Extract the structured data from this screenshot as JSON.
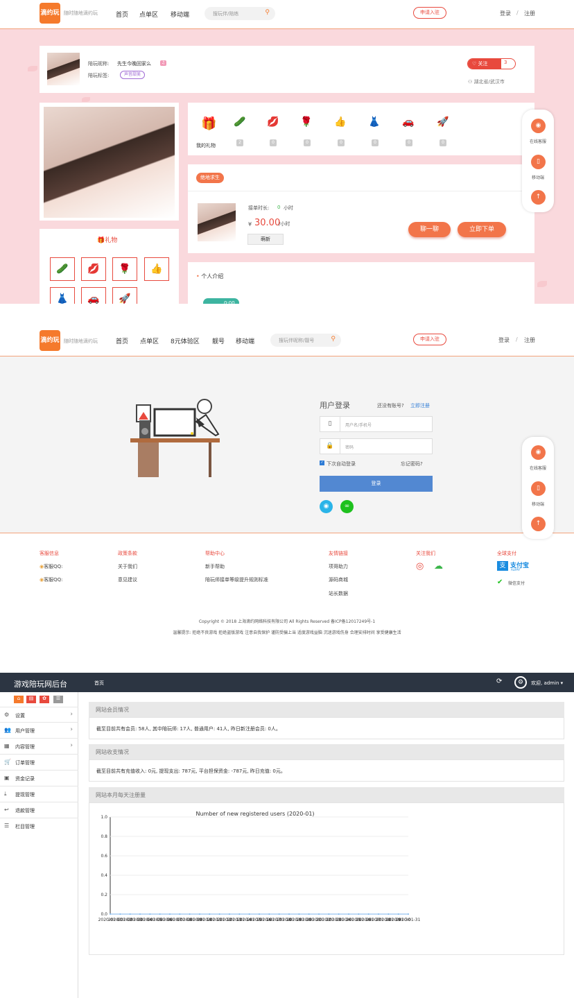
{
  "site": {
    "logo": "滴约玩",
    "slogan": "随时随地滴约玩",
    "nav1": [
      "首页",
      "点单区",
      "移动端"
    ],
    "nav2": [
      "首页",
      "点单区",
      "8元体验区",
      "靓号",
      "移动端"
    ],
    "search1": "搜玩伴/陪练",
    "search2": "搜玩伴昵称/靓号",
    "apply": "申请入驻",
    "login": "登录",
    "sep": "/",
    "register": "注册"
  },
  "profile": {
    "name_label": "陪玩昵称:",
    "name": "先生今晚回家么",
    "tag_label": "陪玩标签:",
    "tag": "声音甜美",
    "follow": "关注",
    "follow_count": "3",
    "location": "湖北省/武汉市"
  },
  "gifts": {
    "title": "我的礼物",
    "items": [
      {
        "icon": "gift-box",
        "emoji": "🎁"
      },
      {
        "icon": "cucumber",
        "emoji": "🥒",
        "count": "2"
      },
      {
        "icon": "lips",
        "emoji": "💋",
        "count": "0"
      },
      {
        "icon": "rose",
        "emoji": "🌹",
        "count": "0"
      },
      {
        "icon": "thumbs-up",
        "emoji": "👍",
        "count": "0"
      },
      {
        "icon": "dress",
        "emoji": "👗",
        "count": "0"
      },
      {
        "icon": "car",
        "emoji": "🚗",
        "count": "0"
      },
      {
        "icon": "rocket",
        "emoji": "🚀",
        "count": "0"
      }
    ],
    "panel_title": "礼物",
    "panel_items": [
      "🥒",
      "💋",
      "🌹",
      "👍",
      "👗",
      "🚗",
      "🚀"
    ]
  },
  "game": {
    "tag": "绝地求生",
    "duration_label": "接单时长:",
    "duration": "0",
    "duration_unit": "小时",
    "currency": "¥",
    "price": "30.00",
    "price_unit": "/小时",
    "newbie": "萌新",
    "chat": "聊一聊",
    "order": "立即下单"
  },
  "intro": {
    "title": "个人介绍",
    "audio": "0:00"
  },
  "side": {
    "service": "在线客服",
    "mobile": "移动端"
  },
  "loginform": {
    "title": "用户登录",
    "no_account": "还没有账号?",
    "signup": "立即注册",
    "user_ph": "用户名/手机号",
    "pass_ph": "密码",
    "remember": "下次自动登录",
    "forgot": "忘记密码?",
    "submit": "登录"
  },
  "footer": {
    "cols": [
      {
        "h": "客服信息",
        "items": [
          "客服QQ:",
          "客服QQ:"
        ]
      },
      {
        "h": "政策条款",
        "items": [
          "关于我们",
          "意见建议"
        ]
      },
      {
        "h": "帮助中心",
        "items": [
          "新手帮助",
          "陪玩师接单等级提升规则标准"
        ]
      },
      {
        "h": "友情链接",
        "items": [
          "项哥助力",
          "源码商城",
          "站长数据"
        ]
      },
      {
        "h": "关注我们",
        "items": []
      },
      {
        "h": "全球支付",
        "items": [
          "支付宝",
          "ALIPAY",
          "微信支付"
        ]
      }
    ],
    "copyright": "Copyright © 2018 上海滴约网络科技有限公司 All Rights Reserved 备ICP备12017249号-1",
    "tips": "温馨提示: 拒绝不良游戏 拒绝盗版游戏 注意自我保护 谨防受骗上当 适度游戏益脑 沉迷游戏伤身 合理安排时间 享受健康生活"
  },
  "admin": {
    "title": "游戏陪玩网后台",
    "tab": "首页",
    "user": "欢迎, admin",
    "menu": [
      {
        "i": "⚙",
        "l": "设置",
        "a": true
      },
      {
        "i": "👥",
        "l": "用户管理",
        "a": true
      },
      {
        "i": "▦",
        "l": "内容管理",
        "a": true
      },
      {
        "i": "🛒",
        "l": "订单管理"
      },
      {
        "i": "▣",
        "l": "资金记录"
      },
      {
        "i": "⤓",
        "l": "提现管理"
      },
      {
        "i": "↩",
        "l": "退款管理"
      },
      {
        "i": "☰",
        "l": "栏目管理"
      }
    ],
    "p1_h": "网站会员情况",
    "p1_b": "截至目前共有会员: 58人, 其中陪玩师: 17人, 普通用户: 41人, 昨日新注册会员: 0人。",
    "p2_h": "网站收支情况",
    "p2_b": "截至目前共有充值收入: 0元, 提现支出: 787元, 平台担保资金: -787元, 昨日充值: 0元。",
    "p3_h": "网站本月每天注册量"
  },
  "chart_data": {
    "type": "line",
    "title": "Number of new registered users (2020-01)",
    "x_first": "2020-01-01",
    "x_last": "2020-01-31",
    "yticks": [
      "0.0",
      "0.2",
      "0.4",
      "0.6",
      "0.8",
      "1.0"
    ],
    "ylim": [
      0,
      1
    ],
    "values": [
      0,
      0,
      0,
      0,
      0,
      0,
      0,
      0,
      0,
      0,
      0,
      0,
      0,
      0,
      0,
      0,
      0,
      0,
      0,
      0,
      0,
      0,
      0,
      0,
      0,
      0,
      0,
      0,
      0,
      0,
      0
    ]
  }
}
